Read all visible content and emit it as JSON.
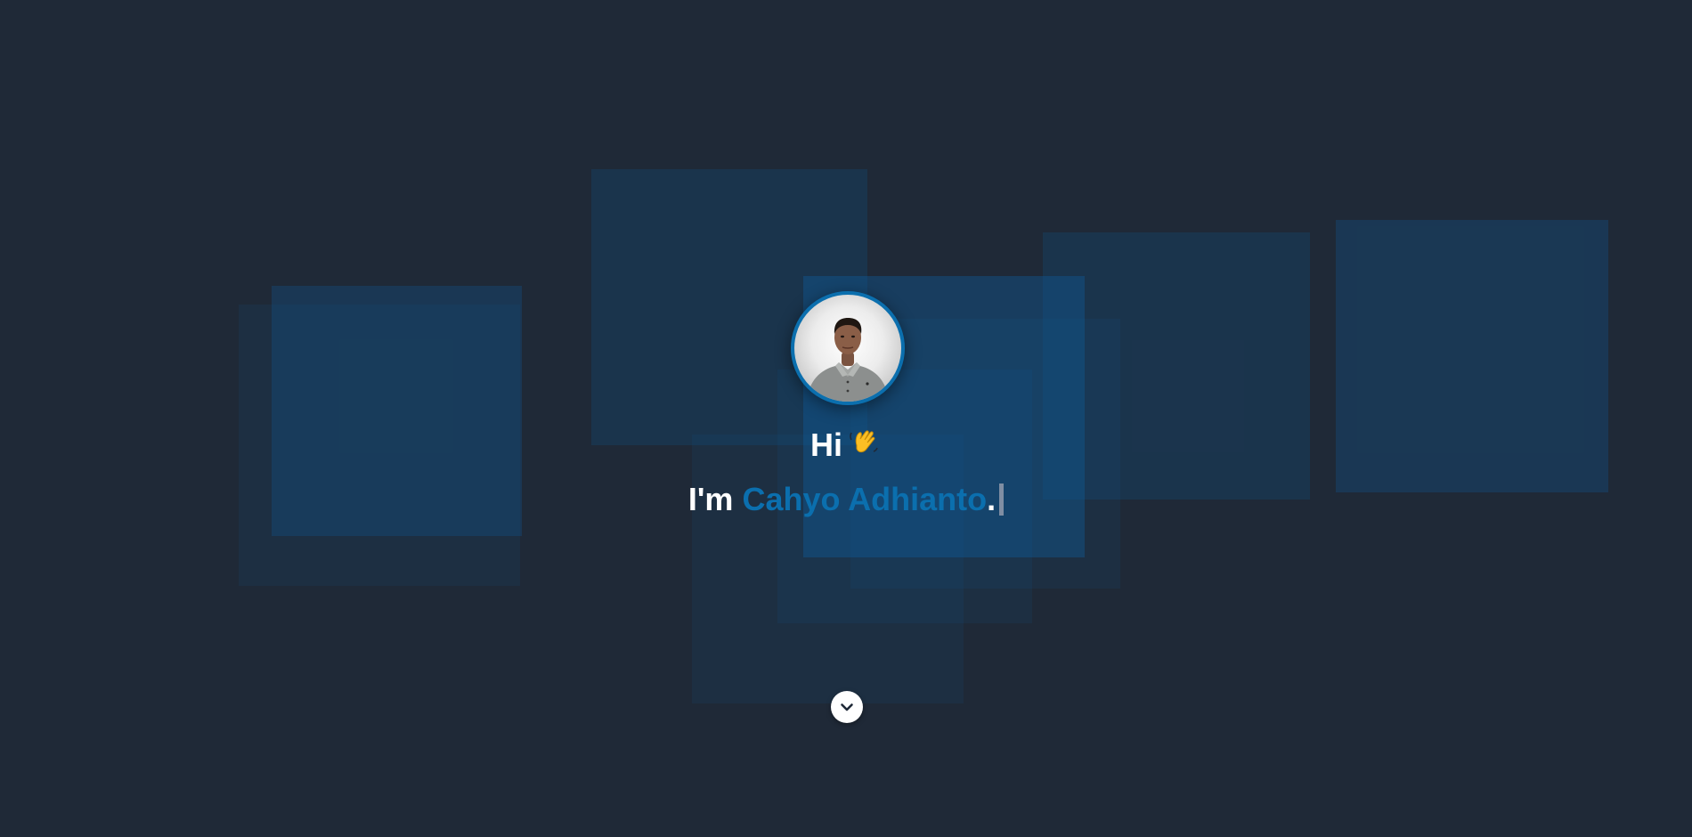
{
  "hero": {
    "greeting": "Hi",
    "greeting_icon": "waving-hand-icon",
    "intro_prefix": "I'm",
    "name": "Cahyo Adhianto",
    "suffix": ".",
    "avatar_icon": "profile-photo",
    "scroll_icon": "chevron-down-icon"
  },
  "colors": {
    "background": "#1f2937",
    "accent": "#0b6fae",
    "text": "#ffffff",
    "cursor": "#7f8ea3"
  }
}
